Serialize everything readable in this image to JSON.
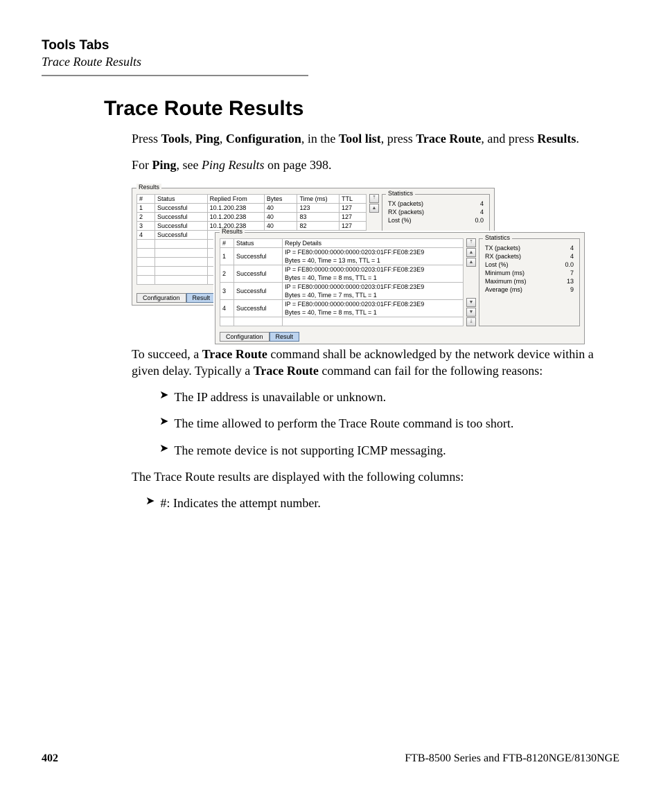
{
  "header": {
    "section": "Tools Tabs",
    "subsection": "Trace Route Results"
  },
  "title": "Trace Route Results",
  "intro": {
    "p1_pre": "Press ",
    "w1": "Tools",
    "s1": ", ",
    "w2": "Ping",
    "s2": ", ",
    "w3": "Configuration",
    "s3": ", in the ",
    "w4": "Tool list",
    "s4": ", press ",
    "w5": "Trace Route",
    "s5": ", and press ",
    "w6": "Results",
    "s6": ".",
    "p2_pre": "For ",
    "p2_b": "Ping",
    "p2_mid": ", see ",
    "p2_i": "Ping Results",
    "p2_post": " on page 398."
  },
  "panel_a": {
    "group": "Results",
    "headers": {
      "num": "#",
      "status": "Status",
      "from": "Replied From",
      "bytes": "Bytes",
      "time": "Time (ms)",
      "ttl": "TTL"
    },
    "rows": [
      {
        "n": "1",
        "status": "Successful",
        "from": "10.1.200.238",
        "bytes": "40",
        "time": "123",
        "ttl": "127"
      },
      {
        "n": "2",
        "status": "Successful",
        "from": "10.1.200.238",
        "bytes": "40",
        "time": "83",
        "ttl": "127"
      },
      {
        "n": "3",
        "status": "Successful",
        "from": "10.1.200.238",
        "bytes": "40",
        "time": "82",
        "ttl": "127"
      },
      {
        "n": "4",
        "status": "Successful",
        "from": "",
        "bytes": "",
        "time": "",
        "ttl": ""
      }
    ],
    "stats_label": "Statistics",
    "stats": [
      {
        "k": "TX (packets)",
        "v": "4"
      },
      {
        "k": "RX (packets)",
        "v": "4"
      },
      {
        "k": "Lost (%)",
        "v": "0.0"
      }
    ],
    "tabs": {
      "config": "Configuration",
      "result": "Result"
    }
  },
  "panel_b": {
    "group": "Results",
    "headers": {
      "num": "#",
      "status": "Status",
      "details": "Reply Details"
    },
    "rows": [
      {
        "n": "1",
        "status": "Successful",
        "d1": "IP = FE80:0000:0000:0000:0203:01FF:FE08:23E9",
        "d2": "Bytes = 40, Time = 13 ms, TTL = 1"
      },
      {
        "n": "2",
        "status": "Successful",
        "d1": "IP = FE80:0000:0000:0000:0203:01FF:FE08:23E9",
        "d2": "Bytes = 40, Time = 8 ms, TTL = 1"
      },
      {
        "n": "3",
        "status": "Successful",
        "d1": "IP = FE80:0000:0000:0000:0203:01FF:FE08:23E9",
        "d2": "Bytes = 40, Time = 7 ms, TTL = 1"
      },
      {
        "n": "4",
        "status": "Successful",
        "d1": "IP = FE80:0000:0000:0000:0203:01FF:FE08:23E9",
        "d2": "Bytes = 40, Time = 8 ms, TTL = 1"
      }
    ],
    "stats_label": "Statistics",
    "stats": [
      {
        "k": "TX (packets)",
        "v": "4"
      },
      {
        "k": "RX (packets)",
        "v": "4"
      },
      {
        "k": "Lost (%)",
        "v": "0.0"
      },
      {
        "k": "Minimum (ms)",
        "v": "7"
      },
      {
        "k": "Maximum (ms)",
        "v": "13"
      },
      {
        "k": "Average (ms)",
        "v": "9"
      }
    ],
    "tabs": {
      "config": "Configuration",
      "result": "Result"
    }
  },
  "explain": {
    "p_pre": "To succeed, a ",
    "b1": "Trace Route",
    "p_mid": " command shall be acknowledged by the network device within a given delay. Typically a ",
    "b2": "Trace Route",
    "p_post": " command can fail for the following reasons:"
  },
  "reasons": {
    "r1": "The IP address is unavailable or unknown.",
    "r2_pre": "The time allowed to perform the ",
    "r2_b": "Trace Route",
    "r2_post": " command is too short.",
    "r3": "The remote device is not supporting ICMP messaging."
  },
  "after_reasons": "The Trace Route results are displayed with the following columns:",
  "cols": {
    "c1_b": "#",
    "c1_t": ": Indicates the attempt number."
  },
  "footer": {
    "page": "402",
    "doc": "FTB-8500 Series and FTB-8120NGE/8130NGE"
  },
  "glyphs": {
    "bullet": "➤",
    "top": "⤒",
    "up": "▲",
    "dn": "▼",
    "bot": "⤓",
    "upline": "▲",
    "dnline": "▼"
  }
}
